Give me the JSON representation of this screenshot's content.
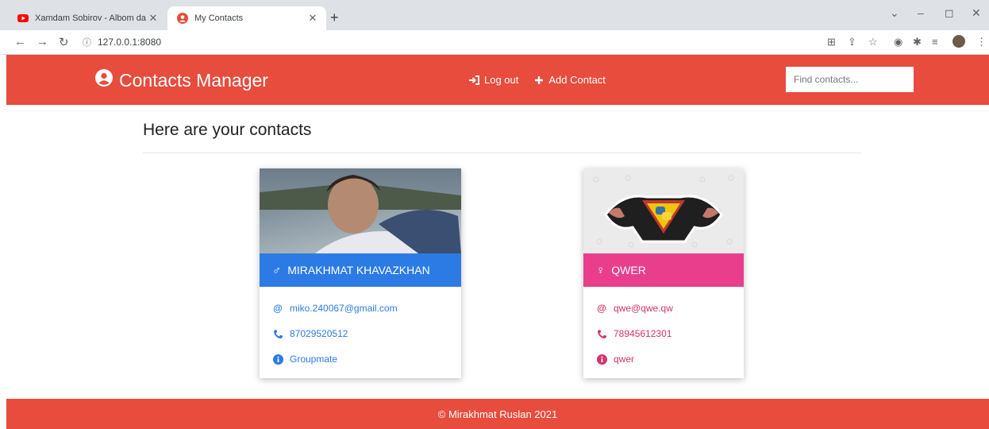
{
  "browser": {
    "tabs": [
      {
        "title": "Xamdam Sobirov - Albom dastu",
        "close": "✕"
      },
      {
        "title": "My Contacts",
        "close": "✕"
      }
    ],
    "address": "127.0.0.1:8080"
  },
  "navbar": {
    "brand": "Contacts Manager",
    "logout_label": "Log out",
    "add_contact_label": "Add Contact",
    "search_placeholder": "Find contacts..."
  },
  "main": {
    "heading": "Here are your contacts",
    "contacts": [
      {
        "name": "MIRAKHMAT KHAVAZKHAN",
        "gender_symbol": "♂",
        "email": "miko.240067@gmail.com",
        "phone": "87029520512",
        "info": "Groupmate",
        "color": "#2c7be5",
        "photo_icon": "person-photo"
      },
      {
        "name": "QWER",
        "gender_symbol": "♀",
        "email": "qwe@qwe.qw",
        "phone": "78945612301",
        "info": "qwer",
        "color": "#e83e8c",
        "photo_icon": "python-superhero-logo"
      }
    ]
  },
  "footer": {
    "text": "© Mirakhmat Ruslan 2021"
  },
  "colors": {
    "brand": "#e74c3c",
    "male": "#2c7be5",
    "female": "#e83e8c"
  }
}
